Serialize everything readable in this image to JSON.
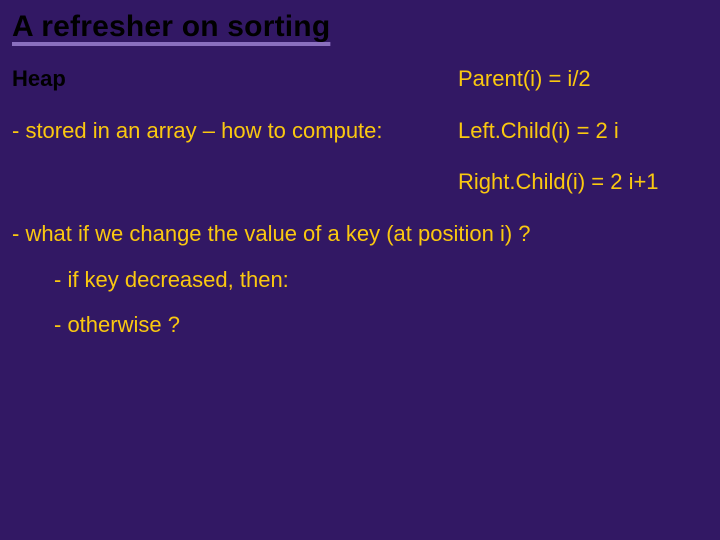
{
  "title": "A refresher on sorting",
  "heap_label": "Heap",
  "bullet_array": "- stored in an array – how to compute:",
  "formulas": {
    "parent": "Parent(i) = i/2",
    "left": "Left.Child(i) = 2 i",
    "right": "Right.Child(i) = 2 i+1"
  },
  "q_change": "- what if we change the value of a key (at position i) ?",
  "sub_dec": "- if key decreased, then:",
  "sub_other": "- otherwise ?"
}
